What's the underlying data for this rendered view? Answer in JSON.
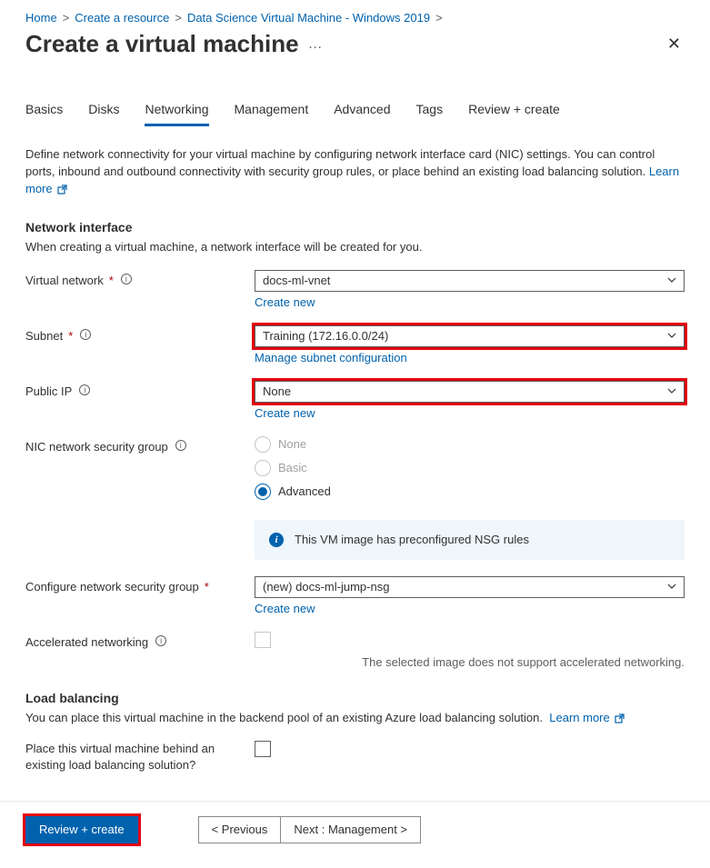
{
  "breadcrumb": {
    "items": [
      "Home",
      "Create a resource",
      "Data Science Virtual Machine - Windows 2019"
    ]
  },
  "title": "Create a virtual machine",
  "tabs": [
    "Basics",
    "Disks",
    "Networking",
    "Management",
    "Advanced",
    "Tags",
    "Review + create"
  ],
  "active_tab_index": 2,
  "intro": "Define network connectivity for your virtual machine by configuring network interface card (NIC) settings. You can control ports, inbound and outbound connectivity with security group rules, or place behind an existing load balancing solution.",
  "learn_more": "Learn more",
  "network_interface": {
    "heading": "Network interface",
    "subtext": "When creating a virtual machine, a network interface will be created for you."
  },
  "fields": {
    "vnet": {
      "label": "Virtual network",
      "value": "docs-ml-vnet",
      "sublink": "Create new",
      "required": true
    },
    "subnet": {
      "label": "Subnet",
      "value": "Training (172.16.0.0/24)",
      "sublink": "Manage subnet configuration",
      "required": true
    },
    "public_ip": {
      "label": "Public IP",
      "value": "None",
      "sublink": "Create new",
      "required": false
    },
    "nsg": {
      "label": "NIC network security group",
      "options": [
        "None",
        "Basic",
        "Advanced"
      ],
      "selected_index": 2
    },
    "info_bar": "This VM image has preconfigured NSG rules",
    "cfg_nsg": {
      "label": "Configure network security group",
      "value": "(new) docs-ml-jump-nsg",
      "sublink": "Create new",
      "required": true
    },
    "accel": {
      "label": "Accelerated networking",
      "note": "The selected image does not support accelerated networking."
    }
  },
  "load_balancing": {
    "heading": "Load balancing",
    "text": "You can place this virtual machine in the backend pool of an existing Azure load balancing solution.",
    "learn_more": "Learn more",
    "checkbox_label": "Place this virtual machine behind an existing load balancing solution?"
  },
  "footer": {
    "primary": "Review + create",
    "prev": "<  Previous",
    "next": "Next : Management  >"
  }
}
